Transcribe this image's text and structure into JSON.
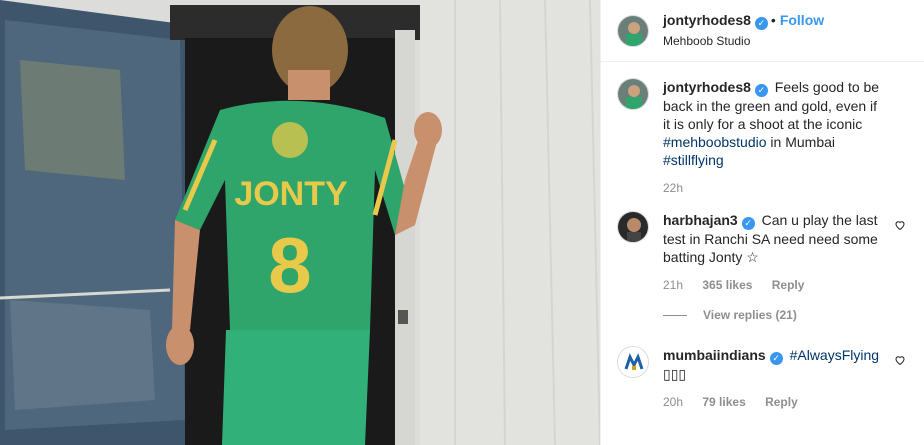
{
  "header": {
    "username": "jontyrhodes8",
    "follow_label": "Follow",
    "location": "Mehboob Studio"
  },
  "caption": {
    "username": "jontyrhodes8",
    "text_1": "Feels good to be back in the green and gold, even if it is only for a shoot at the iconic ",
    "tag_1": "#mehboobstudio",
    "text_2": " in Mumbai ",
    "tag_2": "#stillflying",
    "time": "22h"
  },
  "comments": [
    {
      "username": "harbhajan3",
      "text": "Can u play the last test in Ranchi SA need need some batting Jonty ☆",
      "time": "21h",
      "likes": "365 likes",
      "reply": "Reply",
      "view_replies": "View replies (21)"
    },
    {
      "username": "mumbaiindians",
      "tag": "#AlwaysFlying",
      "text": "▯▯▯",
      "time": "20h",
      "likes": "79 likes",
      "reply": "Reply"
    }
  ],
  "jersey": {
    "name": "JONTY",
    "number": "8"
  },
  "colors": {
    "accent": "#3897f0",
    "jersey_green": "#2fa46b",
    "jersey_yellow": "#e8c94a"
  },
  "icons": {
    "verified": "verified-badge-icon",
    "like": "heart-icon"
  }
}
